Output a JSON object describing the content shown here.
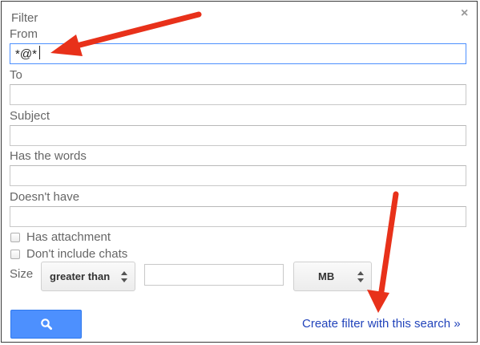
{
  "dialog": {
    "title": "Filter",
    "close_symbol": "×"
  },
  "fields": {
    "from": {
      "label": "From",
      "value": "*@*"
    },
    "to": {
      "label": "To",
      "value": ""
    },
    "subject": {
      "label": "Subject",
      "value": ""
    },
    "has_words": {
      "label": "Has the words",
      "value": ""
    },
    "doesnt_have": {
      "label": "Doesn't have",
      "value": ""
    }
  },
  "checkboxes": {
    "has_attachment": {
      "label": "Has attachment",
      "checked": false
    },
    "dont_include_chats": {
      "label": "Don't include chats",
      "checked": false
    }
  },
  "size": {
    "label": "Size",
    "comparison": "greater than",
    "value": "",
    "unit": "MB"
  },
  "actions": {
    "search_icon": "search-icon",
    "create_filter_link": "Create filter with this search »"
  },
  "annotation": {
    "arrow_color": "#e8311a"
  },
  "colors": {
    "accent_blue": "#4d90fe",
    "link_blue": "#2244bb",
    "label_gray": "#666666"
  }
}
